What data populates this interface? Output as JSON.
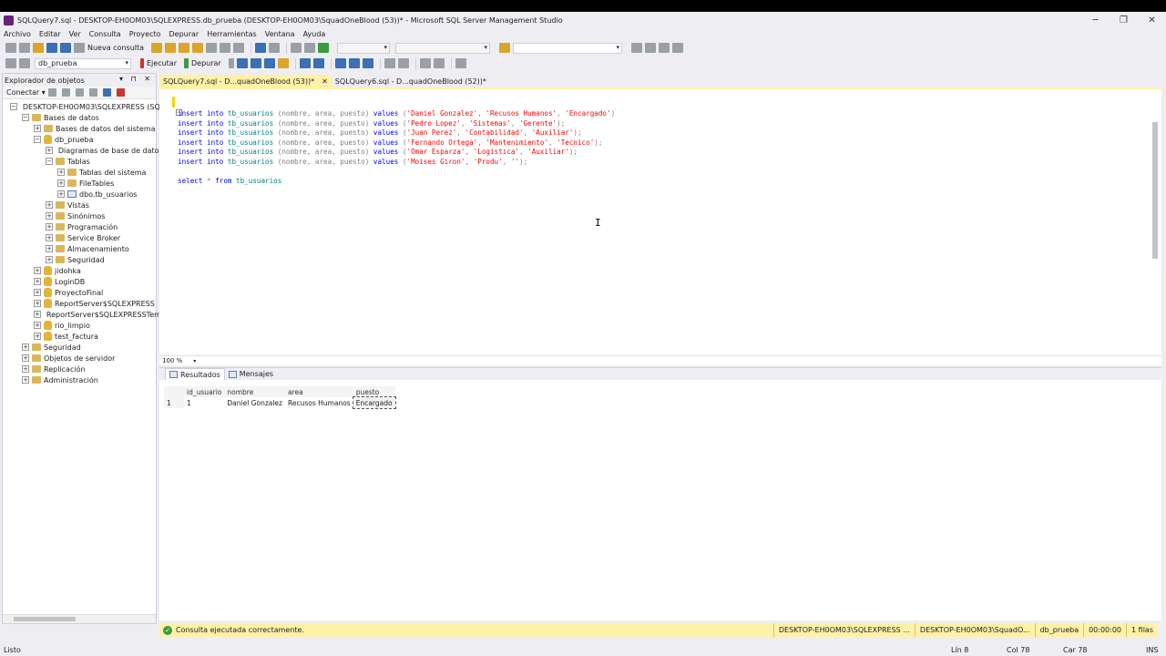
{
  "window": {
    "title": "SQLQuery7.sql - DESKTOP-EH0OM03\\SQLEXPRESS.db_prueba (DESKTOP-EH0OM03\\SquadOneBlood (53))* - Microsoft SQL Server Management Studio",
    "minimize": "─",
    "restore": "❐",
    "close": "✕"
  },
  "menu": [
    "Archivo",
    "Editar",
    "Ver",
    "Consulta",
    "Proyecto",
    "Depurar",
    "Herramientas",
    "Ventana",
    "Ayuda"
  ],
  "toolbar1": {
    "new_query": "Nueva consulta"
  },
  "toolbar2": {
    "database": "db_prueba",
    "execute": "Ejecutar",
    "debug": "Depurar"
  },
  "explorer": {
    "title": "Explorador de objetos",
    "pins": "▾ ⊓ ✕",
    "connect": "Conectar ▾",
    "tree": [
      {
        "label": "DESKTOP-EH0OM03\\SQLEXPRESS (SQL",
        "indent": 0,
        "exp": "−",
        "kind": "server"
      },
      {
        "label": "Bases de datos",
        "indent": 1,
        "exp": "−",
        "kind": "folder"
      },
      {
        "label": "Bases de datos del sistema",
        "indent": 2,
        "exp": "+",
        "kind": "folder"
      },
      {
        "label": "db_prueba",
        "indent": 2,
        "exp": "−",
        "kind": "db"
      },
      {
        "label": "Diagramas de base de datos",
        "indent": 3,
        "exp": "+",
        "kind": "folder"
      },
      {
        "label": "Tablas",
        "indent": 3,
        "exp": "−",
        "kind": "folder"
      },
      {
        "label": "Tablas del sistema",
        "indent": 4,
        "exp": "+",
        "kind": "folder"
      },
      {
        "label": "FileTables",
        "indent": 4,
        "exp": "+",
        "kind": "folder"
      },
      {
        "label": "dbo.tb_usuarios",
        "indent": 4,
        "exp": "+",
        "kind": "table"
      },
      {
        "label": "Vistas",
        "indent": 3,
        "exp": "+",
        "kind": "folder"
      },
      {
        "label": "Sinónimos",
        "indent": 3,
        "exp": "+",
        "kind": "folder"
      },
      {
        "label": "Programación",
        "indent": 3,
        "exp": "+",
        "kind": "folder"
      },
      {
        "label": "Service Broker",
        "indent": 3,
        "exp": "+",
        "kind": "folder"
      },
      {
        "label": "Almacenamiento",
        "indent": 3,
        "exp": "+",
        "kind": "folder"
      },
      {
        "label": "Seguridad",
        "indent": 3,
        "exp": "+",
        "kind": "folder"
      },
      {
        "label": "jidohka",
        "indent": 2,
        "exp": "+",
        "kind": "db"
      },
      {
        "label": "LoginDB",
        "indent": 2,
        "exp": "+",
        "kind": "db"
      },
      {
        "label": "ProyectoFinal",
        "indent": 2,
        "exp": "+",
        "kind": "db"
      },
      {
        "label": "ReportServer$SQLEXPRESS",
        "indent": 2,
        "exp": "+",
        "kind": "db"
      },
      {
        "label": "ReportServer$SQLEXPRESSTemp",
        "indent": 2,
        "exp": "+",
        "kind": "db"
      },
      {
        "label": "rio_limpio",
        "indent": 2,
        "exp": "+",
        "kind": "db"
      },
      {
        "label": "test_factura",
        "indent": 2,
        "exp": "+",
        "kind": "db"
      },
      {
        "label": "Seguridad",
        "indent": 1,
        "exp": "+",
        "kind": "folder"
      },
      {
        "label": "Objetos de servidor",
        "indent": 1,
        "exp": "+",
        "kind": "folder"
      },
      {
        "label": "Replicación",
        "indent": 1,
        "exp": "+",
        "kind": "folder"
      },
      {
        "label": "Administración",
        "indent": 1,
        "exp": "+",
        "kind": "folder"
      }
    ]
  },
  "tabs": [
    {
      "label": "SQLQuery7.sql - D...quadOneBlood (53))*",
      "active": true,
      "close": "✕"
    },
    {
      "label": "SQLQuery6.sql - D...quadOneBlood (52))*",
      "active": false
    }
  ],
  "editor": {
    "lines": [
      {
        "kw": "insert into ",
        "obj": "tb_usuarios ",
        "cols": "(nombre, area, puesto) ",
        "kw2": "values ",
        "vals": [
          [
            "'Daniel Gonzalez'",
            "'Recusos Humanos'",
            "'Encargado'"
          ]
        ],
        "end": ")"
      },
      {
        "kw": "insert into ",
        "obj": "tb_usuarios ",
        "cols": "(nombre, area, puesto) ",
        "kw2": "values ",
        "vals": [
          [
            "'Pedro Lopez'",
            "'Sistemas'",
            "'Gerente'"
          ]
        ],
        "end": ");"
      },
      {
        "kw": "insert into ",
        "obj": "tb_usuarios ",
        "cols": "(nombre, area, puesto) ",
        "kw2": "values ",
        "vals": [
          [
            "'Juan Perez'",
            "'Contabilidad'",
            "'Auxiliar'"
          ]
        ],
        "end": ");"
      },
      {
        "kw": "insert into ",
        "obj": "tb_usuarios ",
        "cols": "(nombre, area, puesto) ",
        "kw2": "values ",
        "vals": [
          [
            "'Fernando Ortega'",
            "'Mantenimiento'",
            "'Tecnico'"
          ]
        ],
        "end": ");"
      },
      {
        "kw": "insert into ",
        "obj": "tb_usuarios ",
        "cols": "(nombre, area, puesto) ",
        "kw2": "values ",
        "vals": [
          [
            "'Omar Esparza'",
            "'Logistica'",
            "'Auxiliar'"
          ]
        ],
        "end": ");"
      },
      {
        "kw": "insert into ",
        "obj": "tb_usuarios ",
        "cols": "(nombre, area, puesto) ",
        "kw2": "values ",
        "vals": [
          [
            "'Moises Giron'",
            "'Produ'",
            "''"
          ]
        ],
        "end": ");"
      }
    ],
    "select_kw": "select ",
    "select_rest": "* ",
    "select_from": "from ",
    "select_obj": "tb_usuarios",
    "zoom": "100 %"
  },
  "results": {
    "tab_results": "Resultados",
    "tab_messages": "Mensajes",
    "columns": [
      "id_usuario",
      "nombre",
      "area",
      "puesto"
    ],
    "rows": [
      {
        "num": "1",
        "cells": [
          "1",
          "Daniel Gonzalez",
          "Recusos Humanos",
          "Encargado"
        ]
      }
    ]
  },
  "query_status": {
    "message": "Consulta ejecutada correctamente.",
    "server": "DESKTOP-EH0OM03\\SQLEXPRESS ...",
    "user": "DESKTOP-EH0OM03\\SquadO...",
    "database": "db_prueba",
    "time": "00:00:00",
    "rows": "1 filas"
  },
  "status": {
    "ready": "Listo",
    "line": "Lín 8",
    "col": "Col 78",
    "car": "Car 78",
    "ins": "INS"
  }
}
